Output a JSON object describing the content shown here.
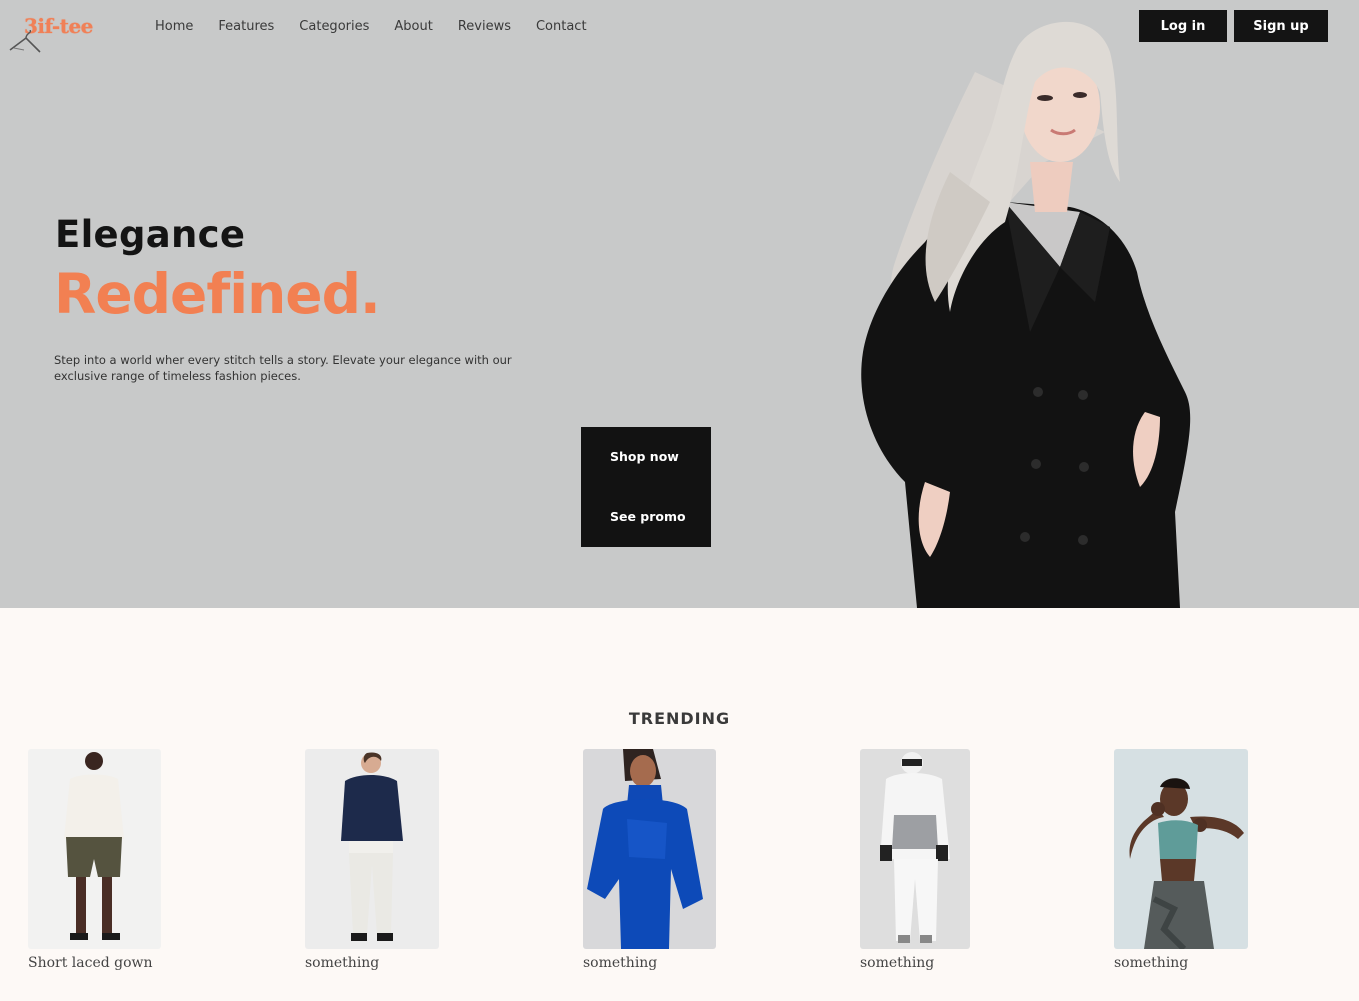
{
  "brand": {
    "logo_text": "3if-tee",
    "accent_color": "#f28052"
  },
  "nav": {
    "items": [
      "Home",
      "Features",
      "Categories",
      "About",
      "Reviews",
      "Contact"
    ]
  },
  "auth": {
    "login_label": "Log in",
    "signup_label": "Sign up"
  },
  "hero": {
    "headline": "Elegance",
    "accent": "Redefined.",
    "subtitle": "Step into a world wher every stitch tells a story. Elevate your elegance with our exclusive range of timeless fashion pieces.",
    "shop_label": "Shop now",
    "promo_label": "See promo"
  },
  "trending": {
    "title": "TRENDING",
    "products": [
      {
        "name": "Short laced gown"
      },
      {
        "name": "something"
      },
      {
        "name": "something"
      },
      {
        "name": "something"
      },
      {
        "name": "something"
      }
    ]
  }
}
